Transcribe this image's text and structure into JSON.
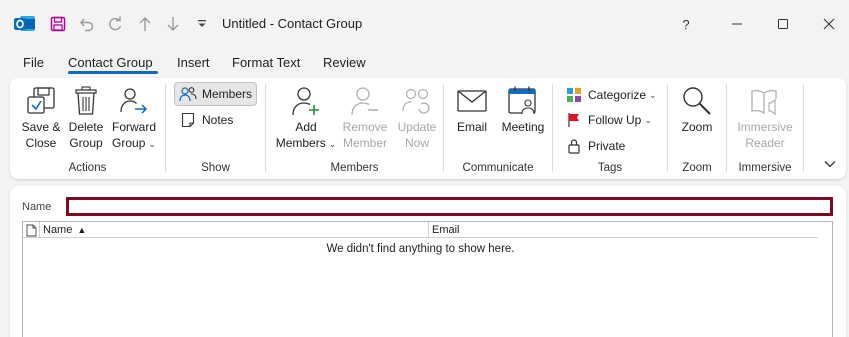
{
  "window": {
    "title": "Untitled  -  Contact Group",
    "help_label": "?",
    "minimize_label": "—",
    "maximize_label": "▢",
    "close_label": "✕"
  },
  "tabs": [
    {
      "label": "File",
      "active": false
    },
    {
      "label": "Contact Group",
      "active": true
    },
    {
      "label": "Insert",
      "active": false
    },
    {
      "label": "Format Text",
      "active": false
    },
    {
      "label": "Review",
      "active": false
    }
  ],
  "ribbon": {
    "actions": {
      "label": "Actions",
      "save_close": [
        "Save &",
        "Close"
      ],
      "delete_group": [
        "Delete",
        "Group"
      ],
      "forward_group": [
        "Forward",
        "Group"
      ]
    },
    "show": {
      "label": "Show",
      "members": "Members",
      "notes": "Notes"
    },
    "members": {
      "label": "Members",
      "add_members": [
        "Add",
        "Members"
      ],
      "remove_member": [
        "Remove",
        "Member"
      ],
      "update_now": [
        "Update",
        "Now"
      ]
    },
    "communicate": {
      "label": "Communicate",
      "email": "Email",
      "meeting": "Meeting"
    },
    "tags": {
      "label": "Tags",
      "categorize": "Categorize",
      "follow_up": "Follow Up",
      "private": "Private"
    },
    "zoom": {
      "label": "Zoom",
      "zoom": "Zoom"
    },
    "immersive": {
      "label": "Immersive",
      "immersive_reader": [
        "Immersive",
        "Reader"
      ]
    }
  },
  "form": {
    "name_label": "Name",
    "name_value": ""
  },
  "list": {
    "columns": [
      "Name",
      "Email"
    ],
    "sort_indicator": "▲",
    "empty_message": "We didn't find anything to show here."
  },
  "colors": {
    "accent": "#0f6cbd",
    "name_border": "#7a0b21",
    "outlook_blue": "#0f6cbd",
    "save_purple": "#b4009e"
  }
}
